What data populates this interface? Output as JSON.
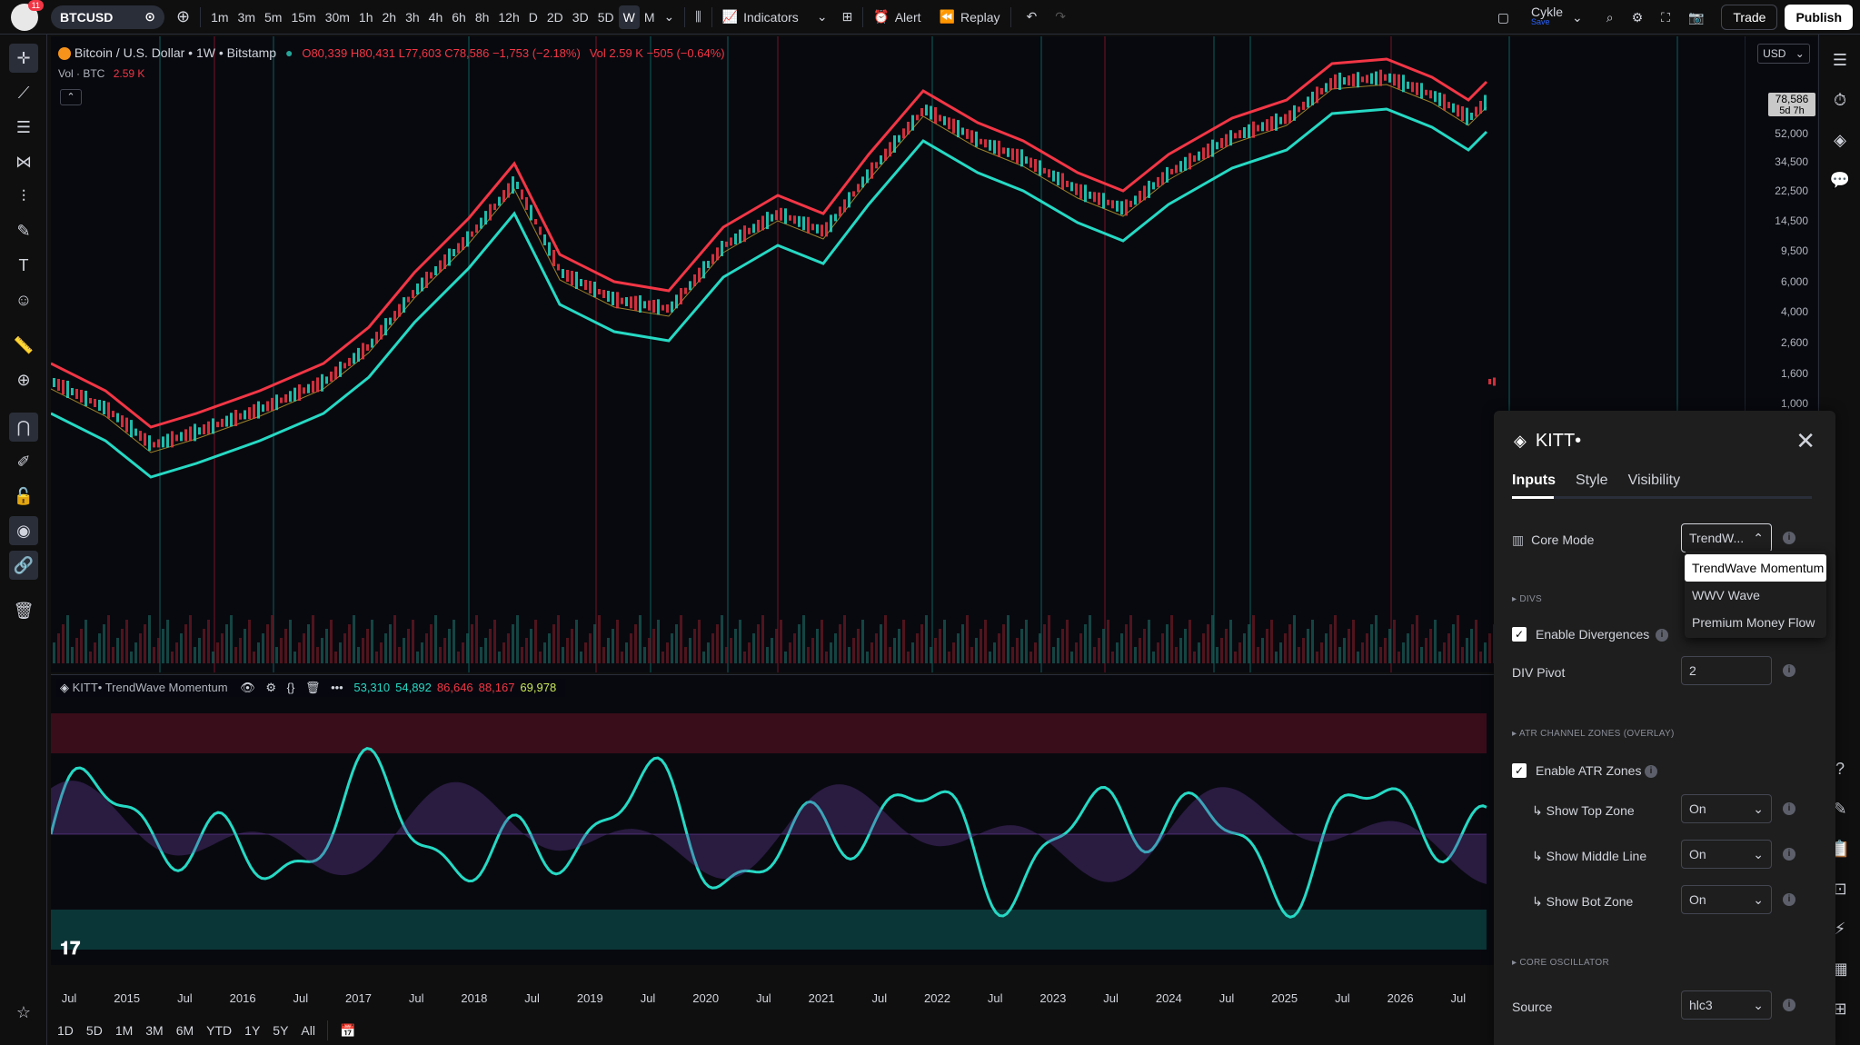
{
  "toolbar": {
    "notification_count": "11",
    "symbol": "BTCUSD",
    "intervals": [
      "1m",
      "3m",
      "5m",
      "15m",
      "30m",
      "1h",
      "2h",
      "3h",
      "4h",
      "6h",
      "8h",
      "12h",
      "D",
      "2D",
      "3D",
      "5D",
      "W",
      "M"
    ],
    "active_interval": "W",
    "indicators_label": "Indicators",
    "alert_label": "Alert",
    "replay_label": "Replay",
    "account_name": "Cykle",
    "account_sub": "Save",
    "trade_label": "Trade",
    "publish_label": "Publish"
  },
  "chart": {
    "title": "Bitcoin / U.S. Dollar • 1W • Bitstamp",
    "ohlc": "O80,339 H80,431 L77,603 C78,586 −1,753 (−2.18%)",
    "volume": "Vol 2.59 K −505 (−0.64%)",
    "vol_label": "Vol · BTC",
    "vol_value": "2.59 K",
    "currency": "USD",
    "price_labels": [
      "52,000",
      "34,500",
      "22,500",
      "14,500",
      "9,500",
      "6,000",
      "4,000",
      "2,600",
      "1,600",
      "1,000"
    ],
    "last_price": "78,586",
    "countdown": "5d 7h"
  },
  "oscillator": {
    "name": "KITT• TrendWave Momentum",
    "values": [
      "53,310",
      "54,892",
      "86,646",
      "88,167",
      "69,978"
    ],
    "value_colors": [
      "#26d9c4",
      "#26d9c4",
      "#f23645",
      "#f23645",
      "#c8e65a"
    ]
  },
  "time_axis": [
    "Jul",
    "2015",
    "Jul",
    "2016",
    "Jul",
    "2017",
    "Jul",
    "2018",
    "Jul",
    "2019",
    "Jul",
    "2020",
    "Jul",
    "2021",
    "Jul",
    "2022",
    "Jul",
    "2023",
    "Jul",
    "2024",
    "Jul",
    "2025",
    "Jul",
    "2026",
    "Jul"
  ],
  "ranges": [
    "1D",
    "5D",
    "1M",
    "3M",
    "6M",
    "YTD",
    "1Y",
    "5Y",
    "All"
  ],
  "panel": {
    "title": "KITT•",
    "tabs": [
      "Inputs",
      "Style",
      "Visibility"
    ],
    "core_mode_label": "Core Mode",
    "core_mode_value": "TrendW...",
    "mode_options": [
      "TrendWave Momentum",
      "WWV Wave",
      "Premium Money Flow"
    ],
    "divs_section": "DIVS",
    "enable_div_label": "Enable Divergences",
    "div_pivot_label": "DIV Pivot",
    "div_pivot_value": "2",
    "atr_section": "ATR CHANNEL ZONES (OVERLAY)",
    "enable_atr_label": "Enable ATR Zones",
    "top_zone_label": "↳ Show Top Zone",
    "top_zone_value": "On",
    "middle_line_label": "↳ Show Middle Line",
    "middle_line_value": "On",
    "bot_zone_label": "↳ Show Bot Zone",
    "bot_zone_value": "On",
    "core_osc_section": "CORE OSCILLATOR",
    "source_label": "Source",
    "source_value": "hlc3"
  },
  "colors": {
    "bull": "#26d9c4",
    "bear": "#f23645",
    "accent_purple": "#6a3fa0"
  }
}
